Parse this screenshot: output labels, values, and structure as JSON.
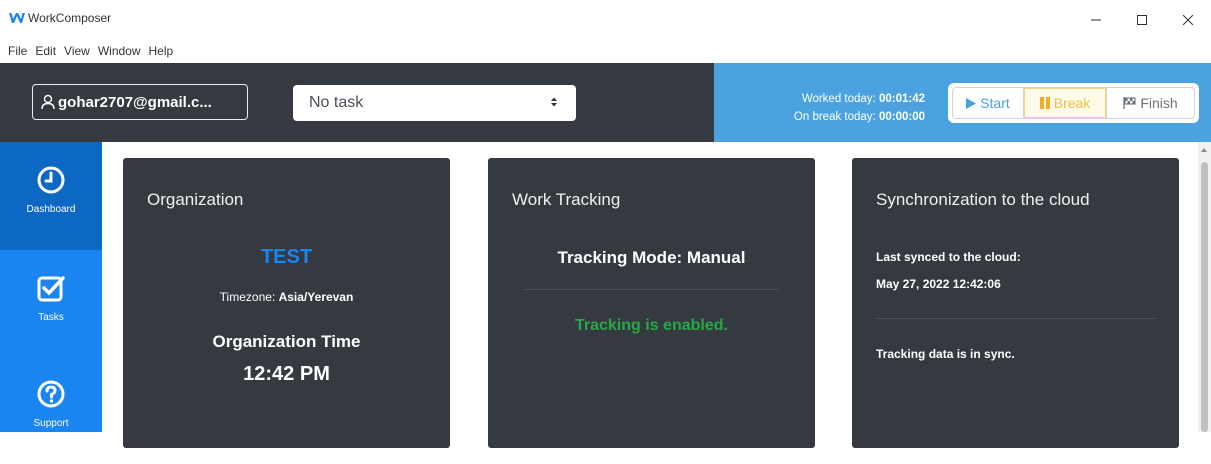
{
  "app": {
    "title": "WorkComposer",
    "icon": "workcomposer-logo"
  },
  "window_controls": {
    "minimize": "—",
    "maximize": "☐",
    "close": "✕"
  },
  "menu": [
    "File",
    "Edit",
    "View",
    "Window",
    "Help"
  ],
  "header": {
    "user_email": "gohar2707@gmail.c...",
    "task_select_value": "No task",
    "worked_today_label": "Worked today:",
    "worked_today_value": "00:01:42",
    "on_break_label": "On break today:",
    "on_break_value": "00:00:00",
    "buttons": {
      "start": "Start",
      "break": "Break",
      "finish": "Finish"
    }
  },
  "sidebar": {
    "items": [
      {
        "label": "Dashboard",
        "icon": "clock-icon",
        "active": true
      },
      {
        "label": "Tasks",
        "icon": "checkbox-icon",
        "active": false
      },
      {
        "label": "Support",
        "icon": "question-icon",
        "active": false
      }
    ]
  },
  "cards": {
    "organization": {
      "title": "Organization",
      "name": "TEST",
      "timezone_label": "Timezone:",
      "timezone_value": "Asia/Yerevan",
      "time_label": "Organization Time",
      "time_value": "12:42 PM"
    },
    "work_tracking": {
      "title": "Work Tracking",
      "mode": "Tracking Mode: Manual",
      "status": "Tracking is enabled."
    },
    "sync": {
      "title": "Synchronization to the cloud",
      "last_synced_label": "Last synced to the cloud:",
      "last_synced_value": "May 27, 2022 12:42:06",
      "status": "Tracking data is in sync."
    }
  },
  "colors": {
    "header_bg": "#343a40",
    "status_bg": "#4aa3e0",
    "sidebar_bg": "#1a85f0",
    "sidebar_active": "#0d68c4",
    "org_name": "#1a85f0",
    "tracking_enabled": "#28a745"
  }
}
